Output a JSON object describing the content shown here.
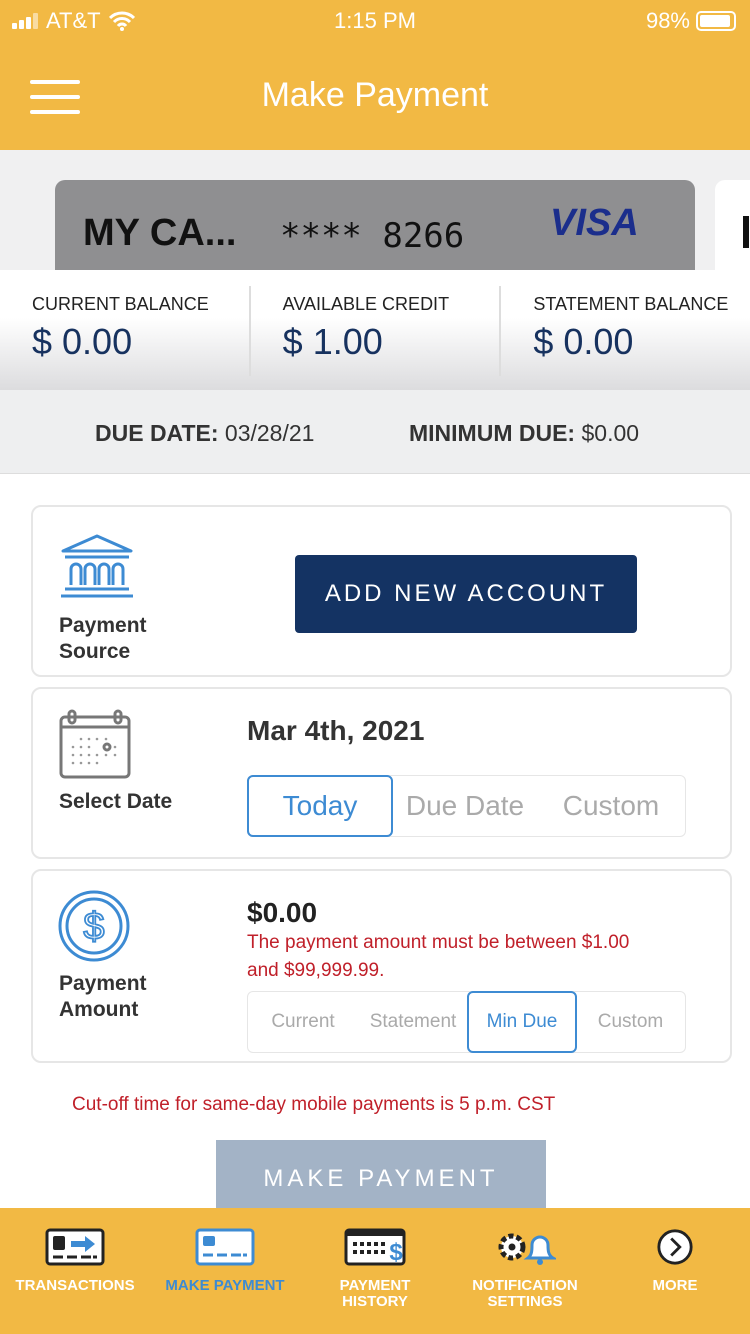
{
  "status_bar": {
    "carrier": "AT&T",
    "time": "1:15 PM",
    "battery": "98%",
    "battery_level": 0.98
  },
  "header": {
    "title": "Make Payment"
  },
  "card": {
    "name": "MY CA...",
    "number": "**** 8266",
    "network": "VISA"
  },
  "balances": [
    {
      "label": "CURRENT BALANCE",
      "value": "$ 0.00"
    },
    {
      "label": "AVAILABLE CREDIT",
      "value": "$ 1.00"
    },
    {
      "label": "STATEMENT BALANCE",
      "value": "$ 0.00"
    }
  ],
  "due": {
    "due_label": "DUE DATE:",
    "due_value": "03/28/21",
    "min_label": "MINIMUM DUE:",
    "min_value": "$0.00"
  },
  "source": {
    "label_1": "Payment",
    "label_2": "Source",
    "button": "ADD NEW ACCOUNT"
  },
  "date": {
    "label": "Select Date",
    "value": "Mar 4th, 2021",
    "options": [
      "Today",
      "Due Date",
      "Custom"
    ],
    "selected": "Today"
  },
  "amount": {
    "label_1": "Payment",
    "label_2": "Amount",
    "value": "$0.00",
    "error_1": "The payment amount must be between $1.00",
    "error_2": "and $99,999.99.",
    "options": [
      "Current",
      "Statement",
      "Min Due",
      "Custom"
    ],
    "selected": "Min Due"
  },
  "cutoff": "Cut-off time for same-day mobile payments is 5 p.m. CST",
  "make_payment": "MAKE PAYMENT",
  "tabs": [
    {
      "label": "TRANSACTIONS",
      "icon": "transactions-icon"
    },
    {
      "label": "MAKE PAYMENT",
      "icon": "card-icon",
      "active": true
    },
    {
      "label_1": "PAYMENT",
      "label_2": "HISTORY",
      "icon": "calendar-dollar-icon"
    },
    {
      "label_1": "NOTIFICATION",
      "label_2": "SETTINGS",
      "icon": "gear-bell-icon"
    },
    {
      "label": "MORE",
      "icon": "chevron-right-circle-icon"
    }
  ],
  "colors": {
    "brand": "#f2b944",
    "navy": "#143363",
    "accent": "#3d8bd3",
    "error": "#c0202a"
  }
}
